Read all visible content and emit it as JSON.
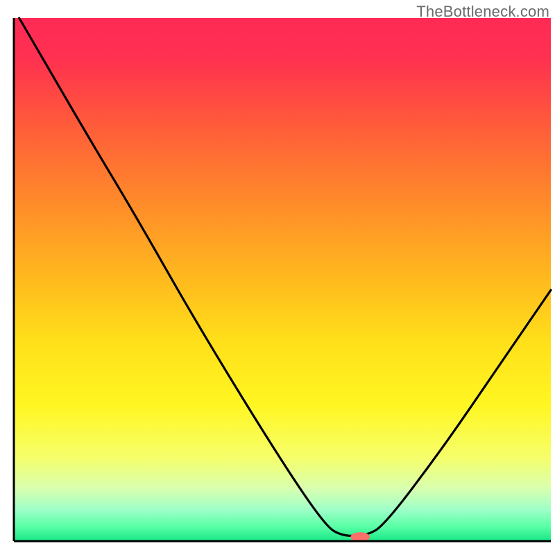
{
  "watermark": "TheBottleneck.com",
  "chart_data": {
    "type": "line",
    "title": "",
    "xlabel": "",
    "ylabel": "",
    "xlim": [
      0,
      100
    ],
    "ylim": [
      0,
      100
    ],
    "gradient_stops": [
      {
        "offset": 0.0,
        "color": "#ff2a55"
      },
      {
        "offset": 0.08,
        "color": "#ff3150"
      },
      {
        "offset": 0.2,
        "color": "#ff5a3a"
      },
      {
        "offset": 0.35,
        "color": "#ff8a2a"
      },
      {
        "offset": 0.5,
        "color": "#ffba1e"
      },
      {
        "offset": 0.62,
        "color": "#ffe01a"
      },
      {
        "offset": 0.74,
        "color": "#fff622"
      },
      {
        "offset": 0.84,
        "color": "#f6ff6a"
      },
      {
        "offset": 0.9,
        "color": "#d8ffb0"
      },
      {
        "offset": 0.94,
        "color": "#9effc8"
      },
      {
        "offset": 0.97,
        "color": "#5effa8"
      },
      {
        "offset": 1.0,
        "color": "#18e886"
      }
    ],
    "series": [
      {
        "name": "bottleneck-curve",
        "points": [
          {
            "x": 1.0,
            "y": 100.0
          },
          {
            "x": 14.0,
            "y": 77.0
          },
          {
            "x": 22.5,
            "y": 62.5
          },
          {
            "x": 35.0,
            "y": 40.0
          },
          {
            "x": 50.0,
            "y": 15.0
          },
          {
            "x": 58.0,
            "y": 3.0
          },
          {
            "x": 61.0,
            "y": 1.0
          },
          {
            "x": 65.5,
            "y": 1.0
          },
          {
            "x": 69.0,
            "y": 3.0
          },
          {
            "x": 80.0,
            "y": 18.0
          },
          {
            "x": 90.0,
            "y": 33.0
          },
          {
            "x": 100.0,
            "y": 48.0
          }
        ]
      }
    ],
    "marker": {
      "x": 64.5,
      "y": 0.8,
      "rx": 1.8,
      "ry": 0.9,
      "color": "#fb7068"
    },
    "axis_color": "#000000",
    "line_color": "#000000"
  }
}
